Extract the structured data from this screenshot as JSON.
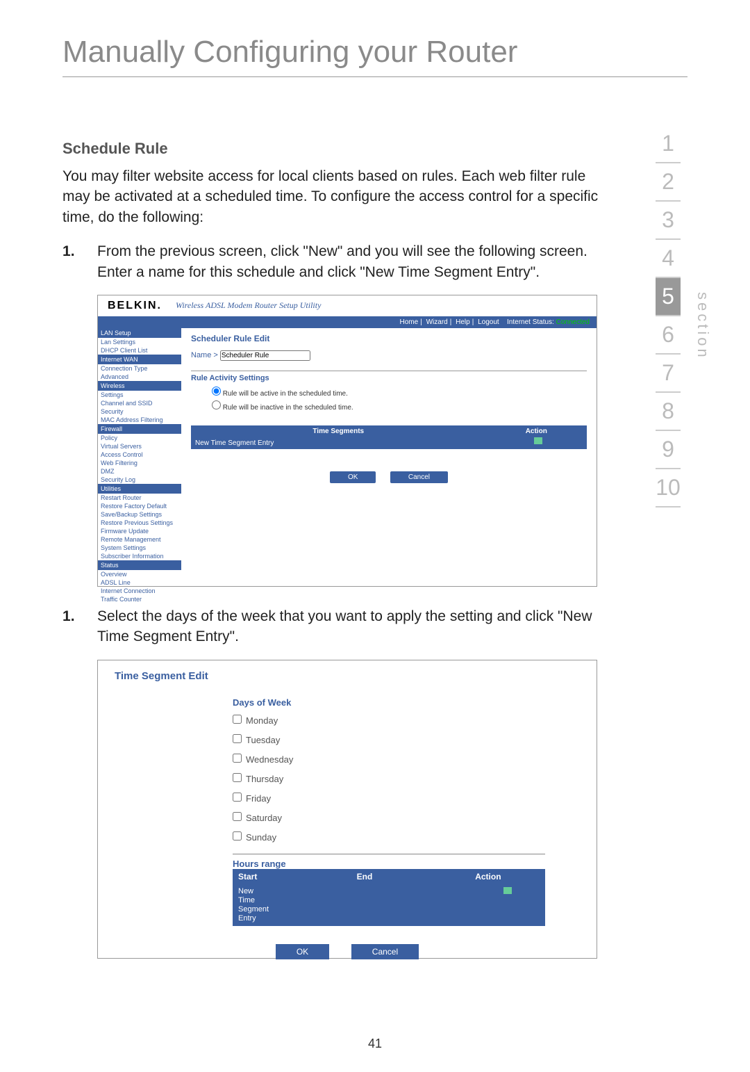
{
  "page_title": "Manually Configuring your Router",
  "section_label": "section",
  "section_numbers": [
    "1",
    "2",
    "3",
    "4",
    "5",
    "6",
    "7",
    "8",
    "9",
    "10"
  ],
  "active_section": "5",
  "page_number": "41",
  "heading": "Schedule Rule",
  "intro": "You may filter website access for local clients based on rules. Each web filter rule may be activated at a scheduled time. To configure the access control for a specific time, do the following:",
  "steps": [
    "From the previous screen, click \"New\" and you will see the following screen. Enter a name for this schedule and click \"New Time Segment Entry\".",
    "Select the days of the week that you want to apply the setting and click \"New Time Segment Entry\"."
  ],
  "shot1": {
    "brand": "BELKIN.",
    "utility": "Wireless ADSL Modem Router Setup Utility",
    "crumbs": [
      "Home",
      "Wizard",
      "Help",
      "Logout"
    ],
    "status_label": "Internet Status:",
    "status_value": "Connected",
    "sidebar": {
      "groups": [
        {
          "header": "LAN Setup",
          "items": [
            "Lan Settings",
            "DHCP Client List"
          ]
        },
        {
          "header": "Internet WAN",
          "items": [
            "Connection Type",
            "Advanced"
          ]
        },
        {
          "header": "Wireless",
          "items": [
            "Settings",
            "Channel and SSID",
            "Security",
            "MAC Address Filtering"
          ]
        },
        {
          "header": "Firewall",
          "items": [
            "Policy",
            "Virtual Servers",
            "Access Control",
            "Web Filtering",
            "DMZ",
            "Security Log"
          ]
        },
        {
          "header": "Utilities",
          "items": [
            "Restart Router",
            "Restore Factory Default",
            "Save/Backup Settings",
            "Restore Previous Settings",
            "Firmware Update",
            "Remote Management",
            "System Settings",
            "Subscriber Information"
          ]
        },
        {
          "header": "Status",
          "items": [
            "Overview",
            "ADSL Line",
            "Internet Connection",
            "Traffic Counter"
          ]
        }
      ]
    },
    "content": {
      "title": "Scheduler Rule Edit",
      "name_label": "Name >",
      "name_value": "Scheduler Rule",
      "ras_title": "Rule Activity Settings",
      "radio_active": "Rule will be active in the scheduled time.",
      "radio_inactive": "Rule will be inactive in the scheduled time.",
      "col1": "Time Segments",
      "col2": "Action",
      "row_label": "New Time Segment Entry",
      "ok": "OK",
      "cancel": "Cancel"
    }
  },
  "shot2": {
    "title": "Time Segment Edit",
    "dow_label": "Days of Week",
    "days": [
      "Monday",
      "Tuesday",
      "Wednesday",
      "Thursday",
      "Friday",
      "Saturday",
      "Sunday"
    ],
    "hours_label": "Hours range",
    "cols": {
      "start": "Start",
      "end": "End",
      "action": "Action"
    },
    "row_label": "New\nTime\nSegment\nEntry",
    "ok": "OK",
    "cancel": "Cancel"
  }
}
